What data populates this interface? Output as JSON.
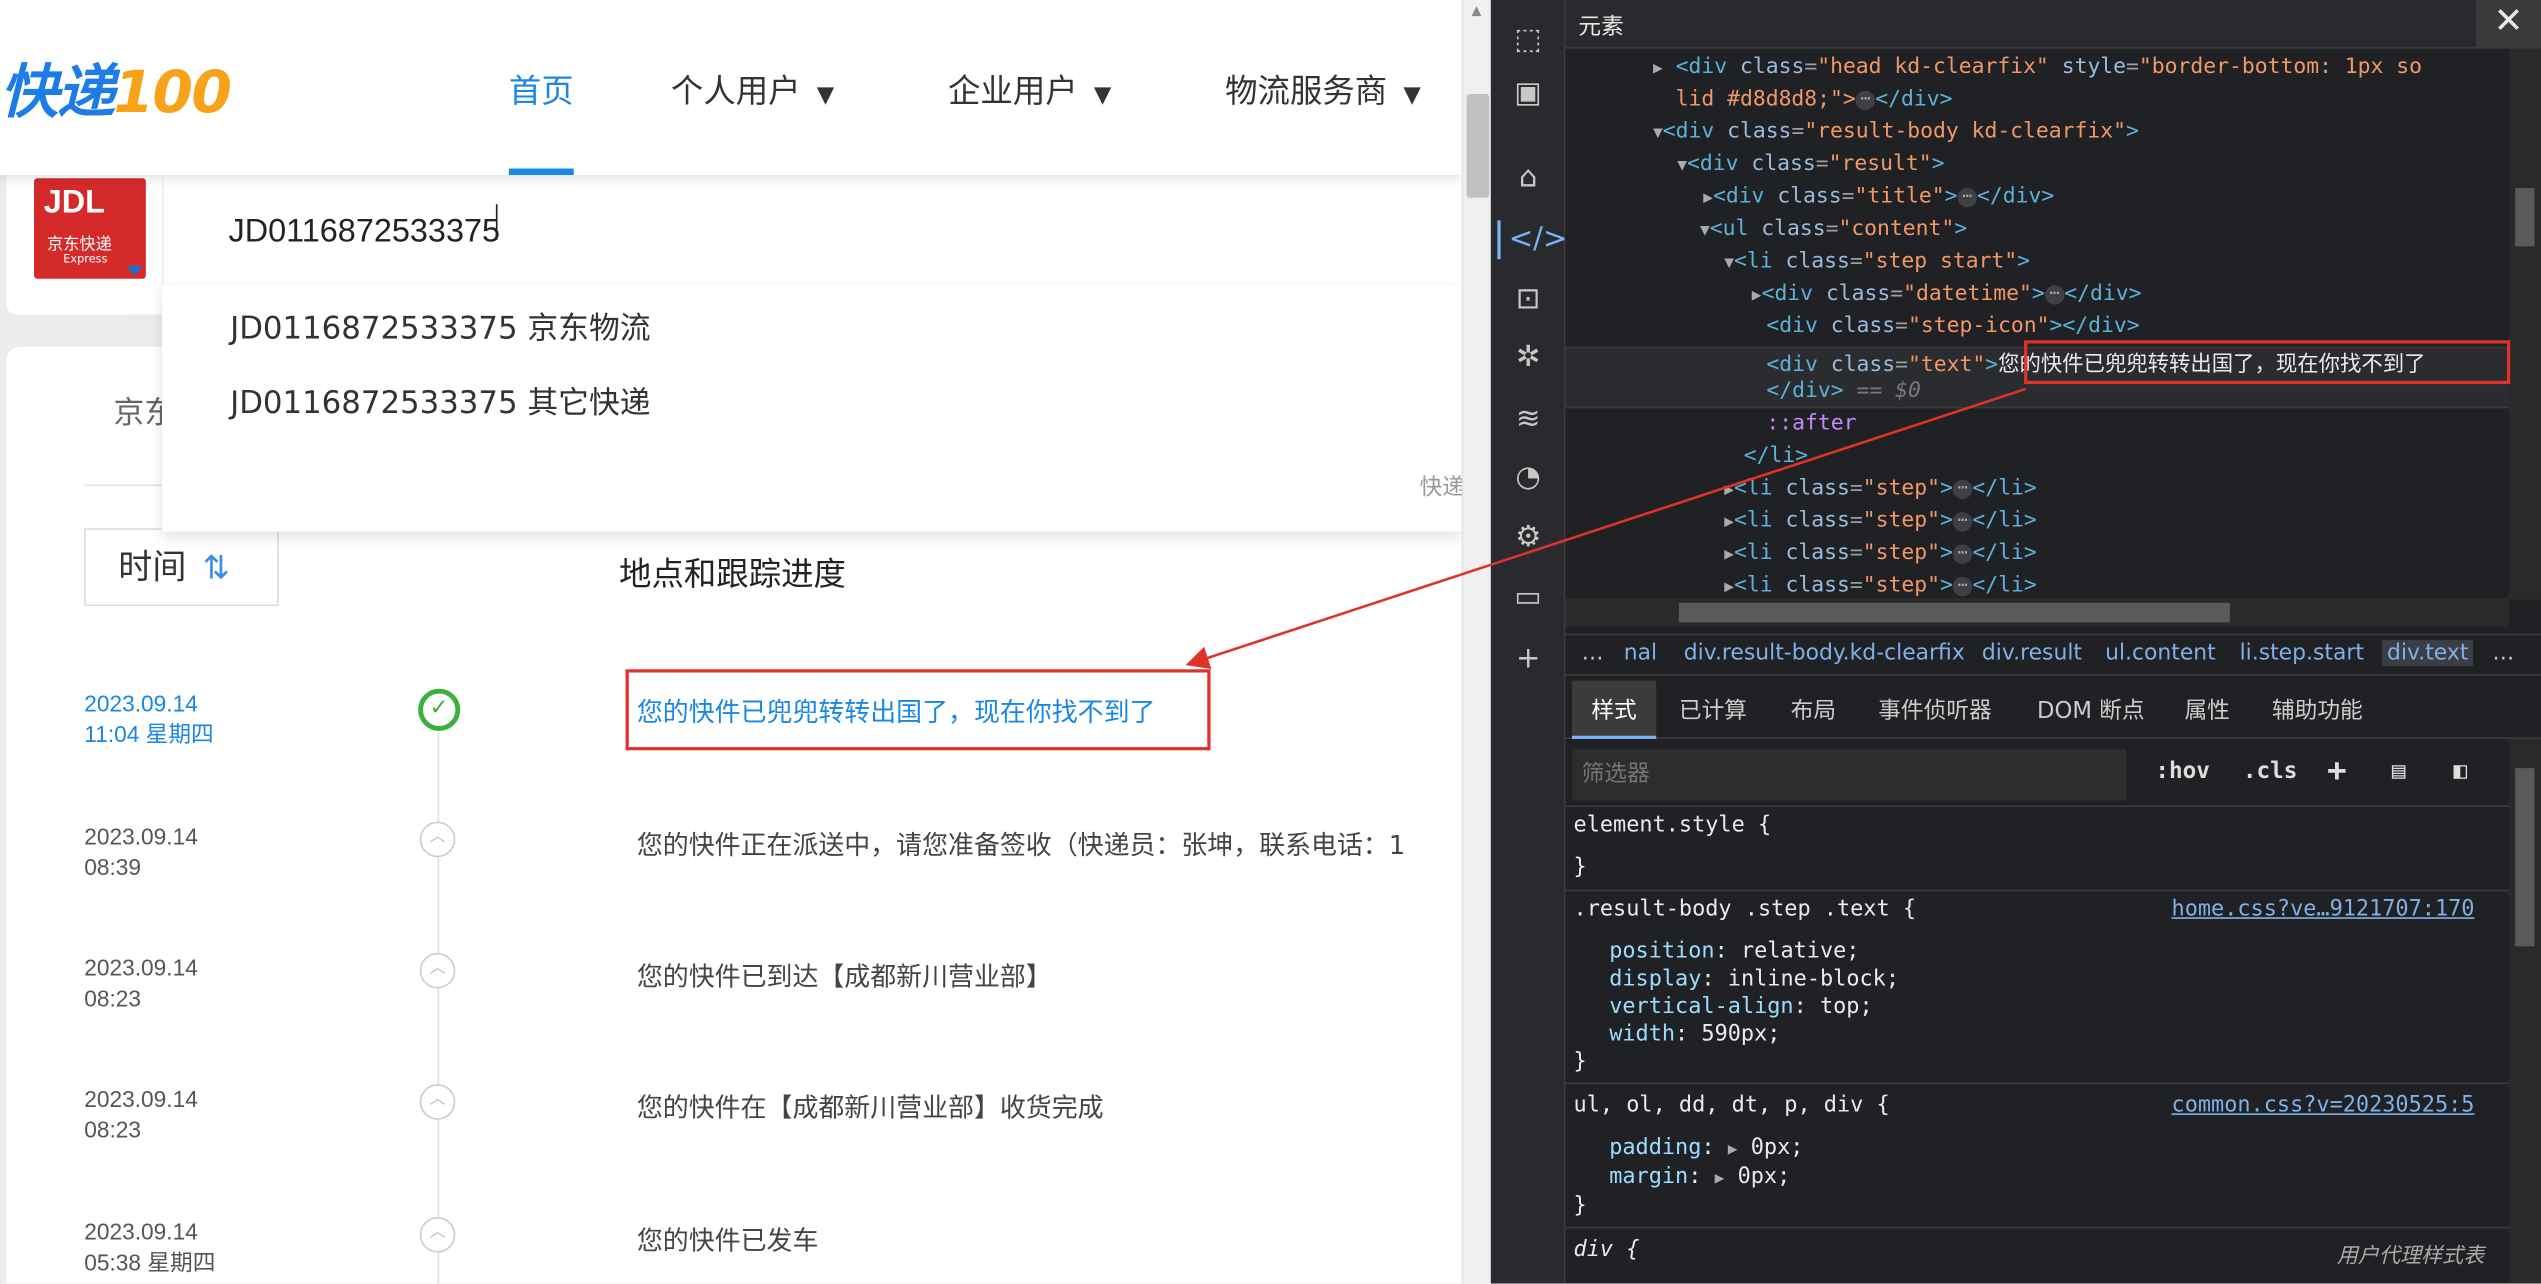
{
  "site": {
    "logo_text": "快递",
    "logo_num": "100",
    "nav": [
      "首页",
      "个人用户",
      "企业用户",
      "物流服务商"
    ],
    "carrier_logo": {
      "brand": "JDL",
      "cn": "京东快递",
      "en": "Express"
    },
    "search_value": "JD0116872533375",
    "suggestions": [
      "JD0116872533375  京东物流",
      "JD0116872533375 其它快递"
    ],
    "dropdown_footer": "快递",
    "partial_tab": "京东",
    "time_button": "时间",
    "sort_icon": "sort-arrows-icon",
    "col_header": "地点和跟踪进度",
    "steps": [
      {
        "date": "2023.09.14",
        "time": "11:04 星期四",
        "text": "您的快件已兜兜转转出国了，现在你找不到了"
      },
      {
        "date": "2023.09.14",
        "time": "08:39",
        "text": "您的快件正在派送中，请您准备签收（快递员：张坤，联系电话：1"
      },
      {
        "date": "2023.09.14",
        "time": "08:23",
        "text": "您的快件已到达【成都新川营业部】"
      },
      {
        "date": "2023.09.14",
        "time": "08:23",
        "text": "您的快件在【成都新川营业部】收货完成"
      },
      {
        "date": "2023.09.14",
        "time": "05:38 星期四",
        "text": "您的快件已发车"
      }
    ]
  },
  "devtools": {
    "panel_title": "元素",
    "close_label": "✕",
    "dom": {
      "l1": "lid #d8d8d8;\">",
      "selected_text": "您的快件已兜兜转转出国了，现在你找不到了",
      "eq0": "== $0",
      "after": "::after"
    },
    "crumbs": [
      "…",
      "nal",
      "div.result-body.kd-clearfix",
      "div.result",
      "ul.content",
      "li.step.start",
      "div.text",
      "…"
    ],
    "tabs": [
      "样式",
      "已计算",
      "布局",
      "事件侦听器",
      "DOM 断点",
      "属性",
      "辅助功能"
    ],
    "filter_placeholder": "筛选器",
    "filter_buttons": [
      ":hov",
      ".cls",
      "+"
    ],
    "rules": {
      "element_style": "element.style {",
      "r1_selector": ".result-body .step .text {",
      "r1_link": "home.css?ve…9121707:170",
      "r1_props": [
        {
          "k": "position",
          "v": "relative;"
        },
        {
          "k": "display",
          "v": "inline-block;"
        },
        {
          "k": "vertical-align",
          "v": "top;"
        },
        {
          "k": "width",
          "v": "590px;"
        }
      ],
      "r2_selector": "ul, ol, dd, dt, p, div {",
      "r2_link": "common.css?v=20230525:5",
      "r2_props": [
        {
          "k": "padding",
          "v": "0px;"
        },
        {
          "k": "margin",
          "v": "0px;"
        }
      ],
      "r3_selector": "div {",
      "r3_ua": "用户代理样式表",
      "close": "}"
    }
  },
  "colors": {
    "accent": "#1a86e6",
    "highlight": "#e0312a",
    "success": "#3cb03c"
  }
}
